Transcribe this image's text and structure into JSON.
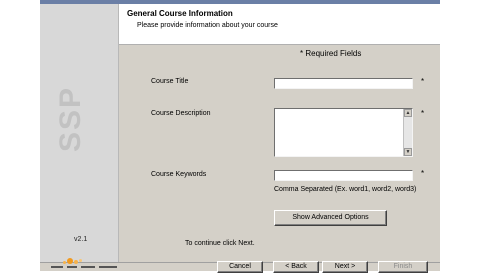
{
  "header": {
    "title": "General Course Information",
    "subtitle": "Please provide information about your course"
  },
  "sidebar": {
    "logo_text": "SSP",
    "version": "v2.1"
  },
  "form": {
    "required_note": "* Required Fields",
    "fields": {
      "title": {
        "label": "Course Title",
        "value": "",
        "required_mark": "*"
      },
      "description": {
        "label": "Course Description",
        "value": "",
        "required_mark": "*"
      },
      "keywords": {
        "label": "Course Keywords",
        "value": "",
        "required_mark": "*",
        "hint": "Comma Separated (Ex. word1, word2, word3)"
      }
    },
    "advanced_button": "Show Advanced Options"
  },
  "footer": {
    "continue_text": "To continue click Next.",
    "buttons": {
      "cancel": "Cancel",
      "back": "< Back",
      "next": "Next >",
      "finish": "Finish"
    }
  },
  "icons": {
    "scroll_up": "scroll-up-arrow-icon",
    "scroll_down": "scroll-down-arrow-icon"
  },
  "colors": {
    "window_bg": "#d4d0c8",
    "header_bg": "#ffffff",
    "sidebar_bg": "#d8d8d8",
    "logo_orange": "#f29a1d"
  }
}
